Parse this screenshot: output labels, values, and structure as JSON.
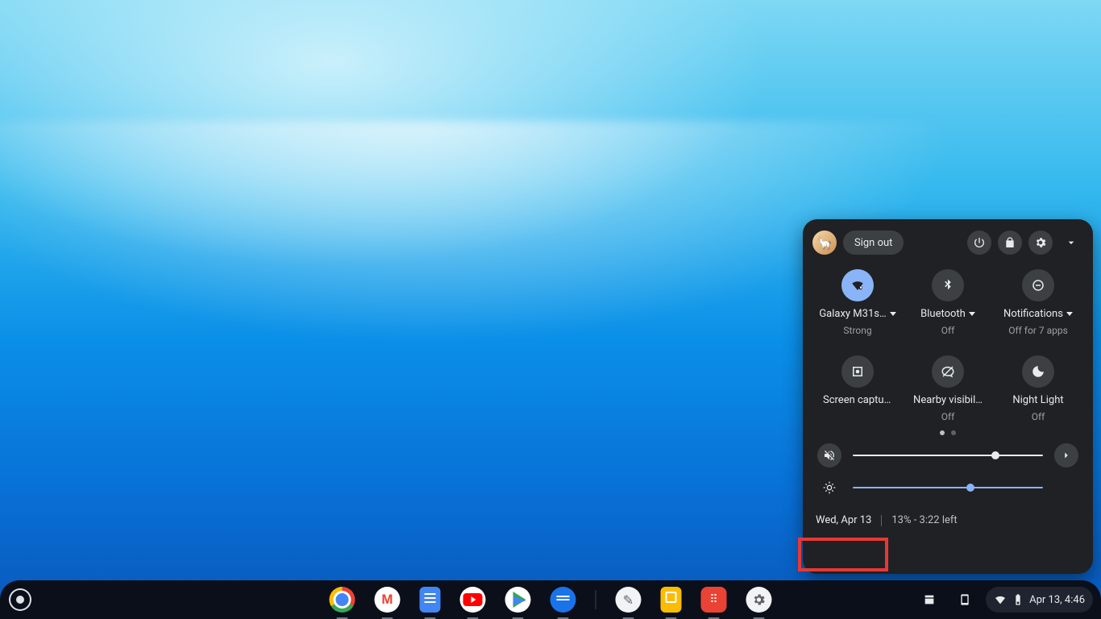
{
  "quick_settings": {
    "sign_out": "Sign out",
    "tiles": [
      {
        "name": "wifi",
        "label": "Galaxy M31s…",
        "sub": "Strong",
        "active": true,
        "caret": true
      },
      {
        "name": "bluetooth",
        "label": "Bluetooth",
        "sub": "Off",
        "active": false,
        "caret": true
      },
      {
        "name": "notifications",
        "label": "Notifications",
        "sub": "Off for 7 apps",
        "active": false,
        "caret": true
      },
      {
        "name": "screencap",
        "label": "Screen capture",
        "sub": "",
        "active": false,
        "caret": false
      },
      {
        "name": "nearby",
        "label": "Nearby visibil…",
        "sub": "Off",
        "active": false,
        "caret": false
      },
      {
        "name": "nightlight",
        "label": "Night Light",
        "sub": "Off",
        "active": false,
        "caret": false
      }
    ],
    "page_dots": {
      "count": 2,
      "active": 0
    },
    "volume_pct": 75,
    "brightness_pct": 62,
    "date": "Wed, Apr 13",
    "battery": "13% - 3:22 left"
  },
  "shelf": {
    "apps": [
      {
        "name": "chrome",
        "label": "Google Chrome"
      },
      {
        "name": "gmail",
        "label": "Gmail"
      },
      {
        "name": "docs",
        "label": "Google Docs"
      },
      {
        "name": "youtube",
        "label": "YouTube"
      },
      {
        "name": "play",
        "label": "Play Store"
      },
      {
        "name": "messages",
        "label": "Messages"
      },
      {
        "name": "canvas",
        "label": "Canvas"
      },
      {
        "name": "keep",
        "label": "Google Keep"
      },
      {
        "name": "app-red",
        "label": "App"
      },
      {
        "name": "settings",
        "label": "Settings"
      }
    ],
    "clock": "Apr 13, 4:46"
  },
  "colors": {
    "accent": "#8ab4f8",
    "panel": "#202124",
    "shelf": "#0b0f1a"
  }
}
